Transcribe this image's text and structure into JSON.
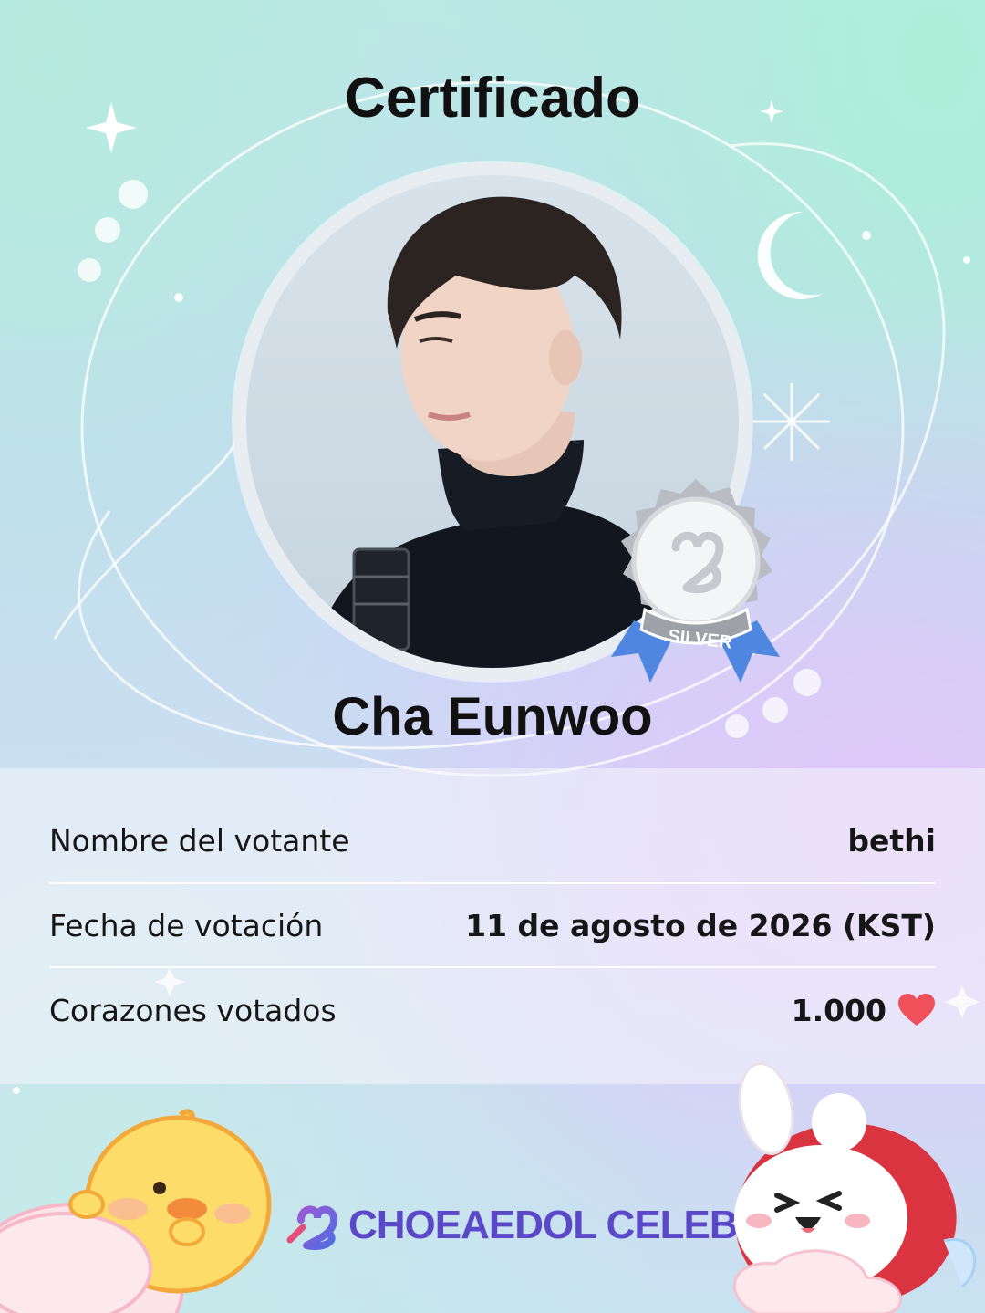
{
  "certificate": {
    "title": "Certificado",
    "celebrity_name": "Cha Eunwoo",
    "badge_label": "SILVER"
  },
  "details": [
    {
      "label": "Nombre del votante",
      "value": "bethi"
    },
    {
      "label": "Fecha de votación",
      "value": "11 de agosto de 2026 (KST)"
    },
    {
      "label": "Corazones votados",
      "value": "1.000"
    }
  ],
  "icons": {
    "hearts_icon": "heart-icon",
    "brand_icon": "choeaedol-heart-logo-icon"
  },
  "brand": {
    "name": "CHOEAEDOL CELEB"
  },
  "colors": {
    "heart": "#f0505a",
    "brand": "#5b48c8",
    "badge_ribbon": "#4f86e0"
  }
}
